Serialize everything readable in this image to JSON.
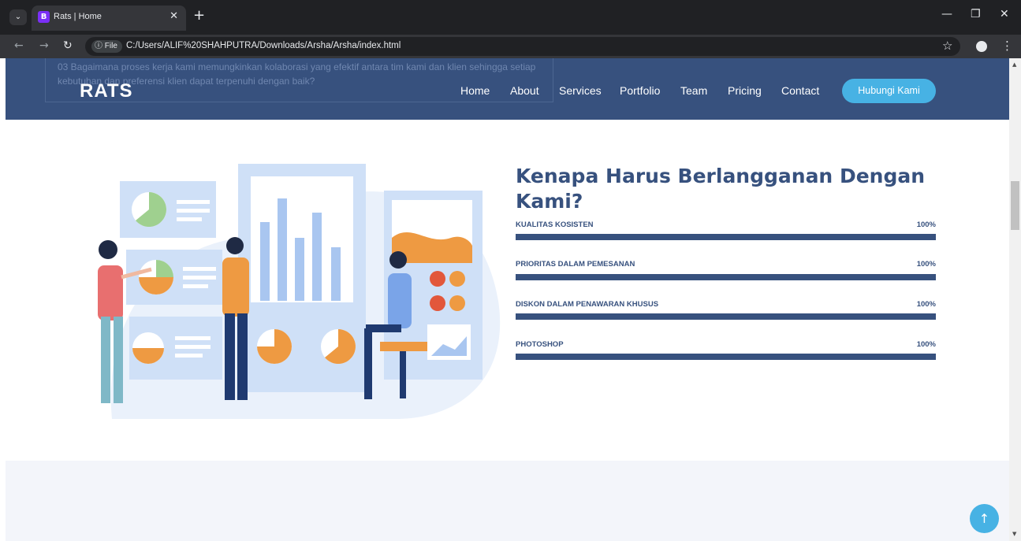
{
  "browser": {
    "tab_title": "Rats | Home",
    "favicon_letter": "B",
    "site_info_label": "File",
    "url": "C:/Users/ALIF%20SHAHPUTRA/Downloads/Arsha/Arsha/index.html"
  },
  "page": {
    "ghost_text": "03 Bagaimana proses kerja kami memungkinkan kolaborasi yang efektif antara tim kami dan klien sehingga setiap kebutuhan dan preferensi klien dapat terpenuhi dengan baik?",
    "logo": "RATS",
    "nav": {
      "home": "Home",
      "about": "About",
      "services": "Services",
      "portfolio": "Portfolio",
      "team": "Team",
      "pricing": "Pricing",
      "contact": "Contact",
      "cta": "Hubungi Kami"
    },
    "skills": {
      "title": "Kenapa Harus Berlangganan Dengan Kami?",
      "items": [
        {
          "name": "KUALITAS KOSISTEN",
          "label": "100%",
          "value": 1.0
        },
        {
          "name": "PRIORITAS DALAM PEMESANAN",
          "label": "100%",
          "value": 1.0
        },
        {
          "name": "DISKON DALAM PENAWARAN KHUSUS",
          "label": "100%",
          "value": 1.0
        },
        {
          "name": "PHOTOSHOP",
          "label": "100%",
          "value": 1.0
        }
      ]
    }
  },
  "colors": {
    "brand": "#37517e",
    "accent": "#47b2e4"
  }
}
